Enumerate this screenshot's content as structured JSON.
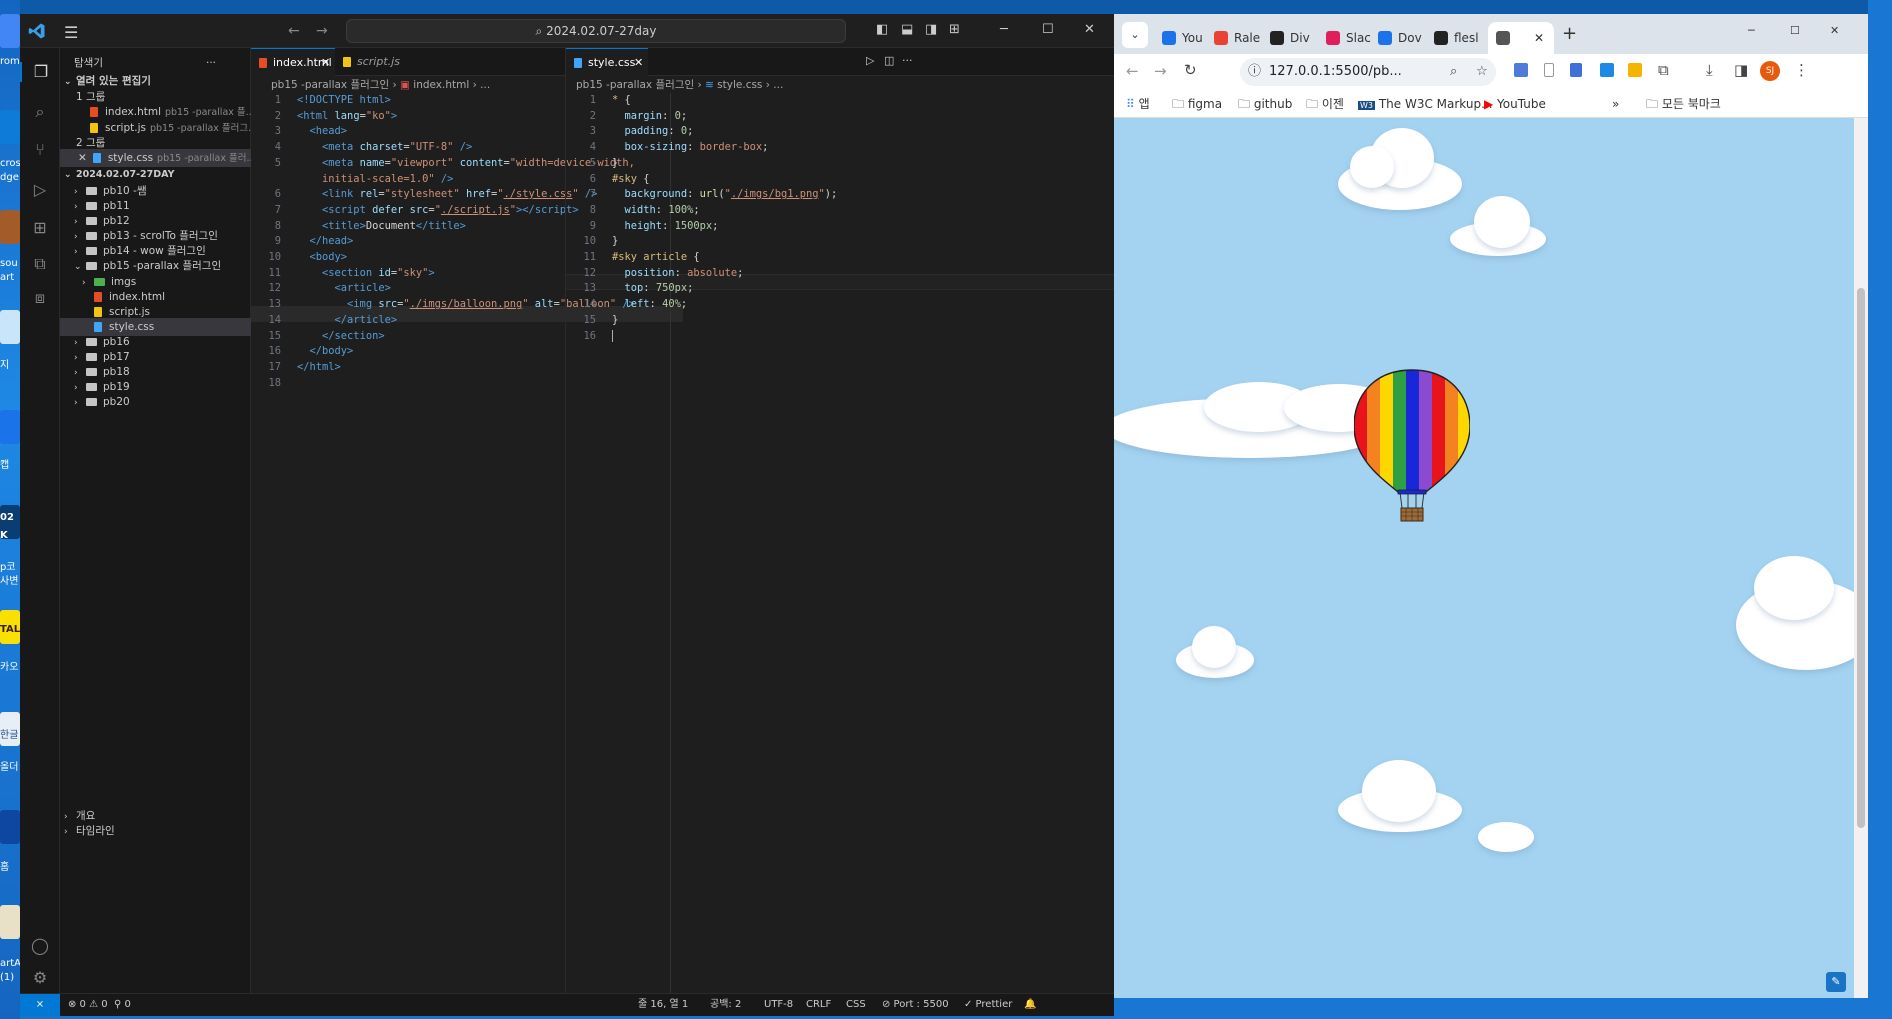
{
  "desktop": {
    "left_labels": [
      "rom",
      "cros",
      "dge",
      "sou",
      "art",
      "지",
      "캡",
      "02",
      "K",
      "p코",
      "사변",
      "TALK",
      "카오",
      "한글",
      "올더",
      "홈",
      "artA",
      "(1)"
    ]
  },
  "vscode": {
    "command_center": "2024.02.07-27day",
    "sidebar": {
      "title": "탐색기",
      "open_editors_label": "열려 있는 편집기",
      "group1_label": "1 그룹",
      "group2_label": "2 그룹",
      "open_editors": [
        {
          "name": "index.html",
          "desc": "pb15 -parallax 플..."
        },
        {
          "name": "script.js",
          "desc": "pb15 -parallax 플러그..."
        },
        {
          "name": "style.css",
          "desc": "pb15 -parallax 플러..."
        }
      ],
      "workspace_label": "2024.02.07-27DAY",
      "tree": [
        "pb10 -쌤",
        "pb11",
        "pb12",
        "pb13 - scrolTo 플러그인",
        "pb14 - wow 플러그인",
        "pb15 -parallax 플러그인",
        "imgs",
        "index.html",
        "script.js",
        "style.css",
        "pb16",
        "pb17",
        "pb18",
        "pb19",
        "pb20"
      ],
      "outline_label": "개요",
      "timeline_label": "타임라인"
    },
    "left_editor": {
      "tabs": [
        {
          "label": "index.html"
        },
        {
          "label": "script.js"
        }
      ],
      "breadcrumb": {
        "folder": "pb15 -parallax 플러그인",
        "file": "index.html",
        "rest": "..."
      },
      "line_numbers": [
        "1",
        "2",
        "3",
        "4",
        "5",
        "",
        "6",
        "7",
        "8",
        "9",
        "10",
        "11",
        "12",
        "13",
        "14",
        "15",
        "16",
        "17",
        "18"
      ]
    },
    "right_editor": {
      "tabs": [
        {
          "label": "style.css"
        }
      ],
      "breadcrumb": {
        "folder": "pb15 -parallax 플러그인",
        "file": "style.css",
        "rest": "..."
      },
      "line_numbers": [
        "1",
        "2",
        "3",
        "4",
        "5",
        "6",
        "7",
        "8",
        "9",
        "10",
        "11",
        "12",
        "13",
        "14",
        "15",
        "16"
      ]
    },
    "status": {
      "problems": "⊗ 0 ⚠ 0",
      "ports": "⚲ 0",
      "position": "줄 16, 열 1",
      "spaces": "공백: 2",
      "encoding": "UTF-8",
      "eol": "CRLF",
      "language": "CSS",
      "port": "⊘ Port : 5500",
      "prettier": "✓ Prettier"
    }
  },
  "chrome": {
    "tabs": [
      {
        "label": "You",
        "color": "#1a73e8"
      },
      {
        "label": "Rale",
        "color": "#ea4335"
      },
      {
        "label": "Div",
        "color": "#222222"
      },
      {
        "label": "Slac",
        "color": "#e01e5a"
      },
      {
        "label": "Dov",
        "color": "#1a73e8"
      },
      {
        "label": "flesl",
        "color": "#222222"
      },
      {
        "label": "",
        "color": "#555555"
      }
    ],
    "url": "127.0.0.1:5500/pb...",
    "profile_initials": "SJ",
    "bookmarks": [
      "앱",
      "figma",
      "github",
      "이젠",
      "The W3C Markup...",
      "YouTube"
    ],
    "all_bookmarks": "모든 북마크"
  },
  "colors": {
    "sky": "#a3d3f1",
    "vscode_accent": "#0078d4"
  }
}
